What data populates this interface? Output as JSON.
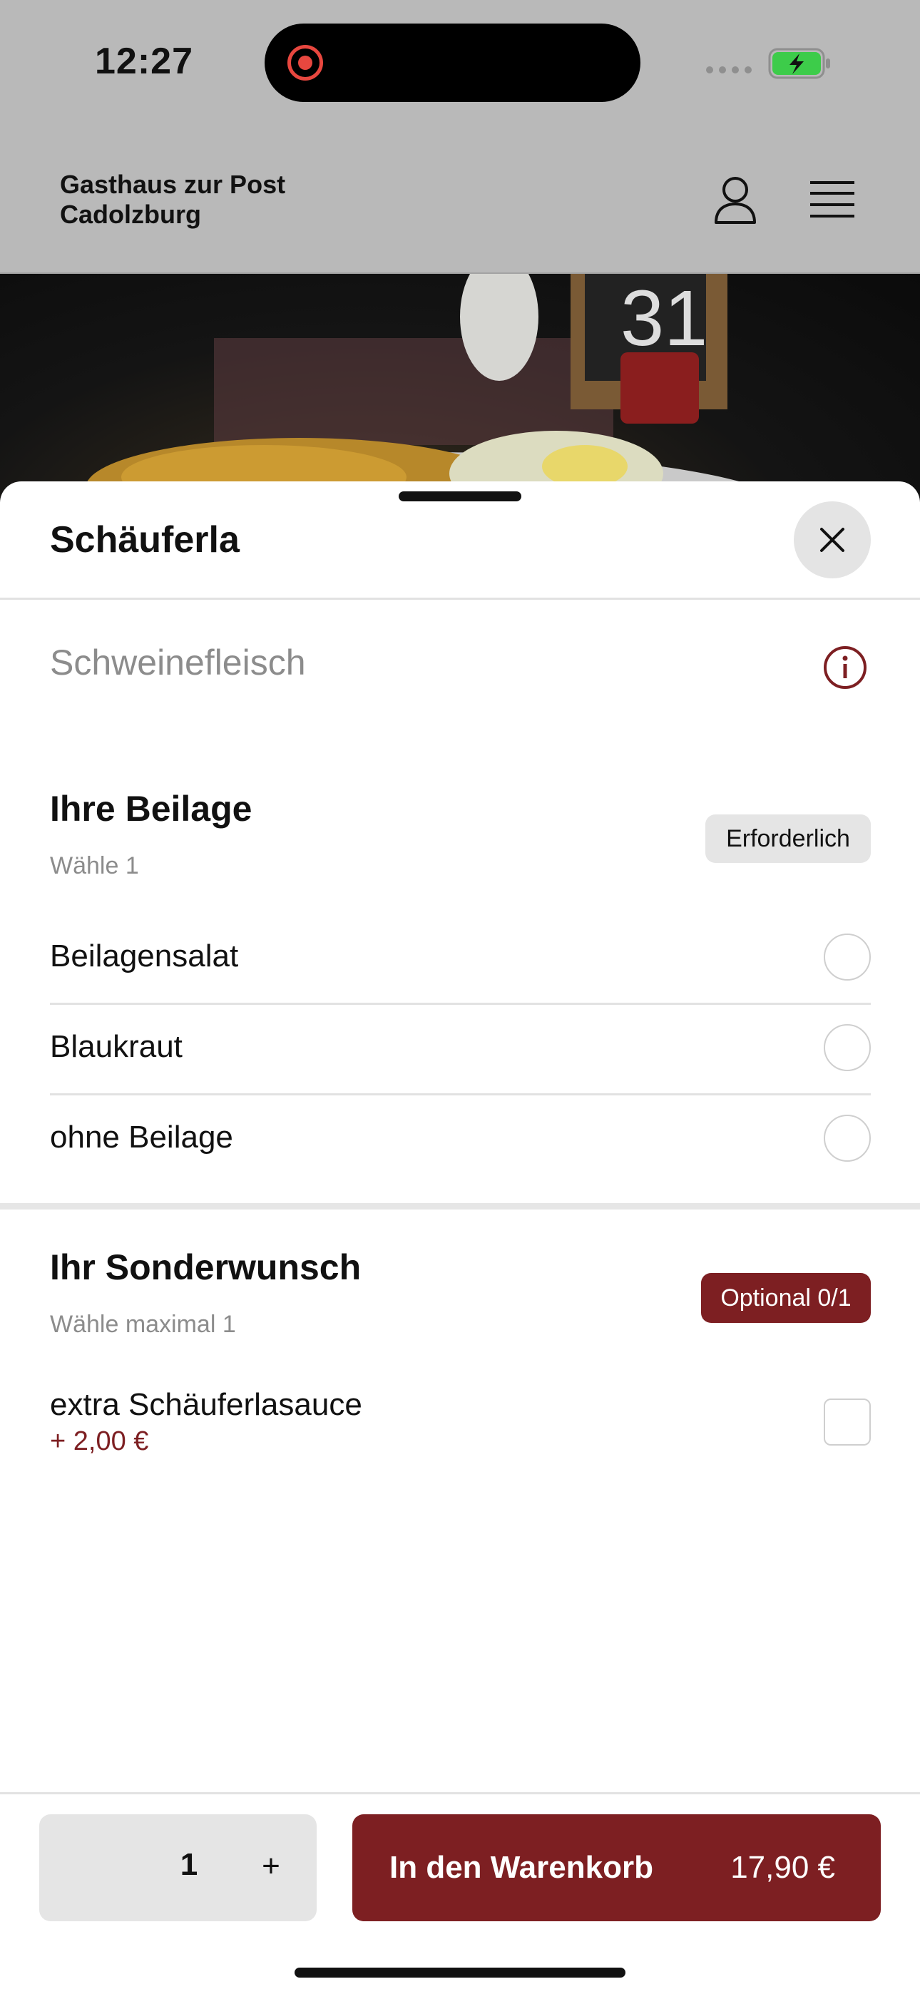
{
  "status_bar": {
    "time": "12:27"
  },
  "header": {
    "brand_line1": "Gasthaus zur Post",
    "brand_line2": "Cadolzburg"
  },
  "sheet": {
    "title": "Schäuferla",
    "description": "Schweinefleisch",
    "groups": [
      {
        "title": "Ihre Beilage",
        "subtitle": "Wähle 1",
        "badge": "Erforderlich",
        "options": [
          {
            "label": "Beilagensalat"
          },
          {
            "label": "Blaukraut"
          },
          {
            "label": "ohne Beilage"
          }
        ]
      },
      {
        "title": "Ihr Sonderwunsch",
        "subtitle": "Wähle maximal 1",
        "badge": "Optional 0/1",
        "options": [
          {
            "label": "extra Schäuferlasauce",
            "price": "+ 2,00 €"
          }
        ]
      }
    ]
  },
  "footer": {
    "quantity": "1",
    "plus_label": "+",
    "cart_label": "In den Warenkorb",
    "cart_price": "17,90 €"
  },
  "colors": {
    "accent": "#7d1f22",
    "overlay": "#b9b9b9",
    "chip": "#e5e5e5"
  },
  "icons": [
    "record-icon",
    "battery-icon",
    "user-icon",
    "menu-icon",
    "close-icon",
    "info-icon"
  ]
}
